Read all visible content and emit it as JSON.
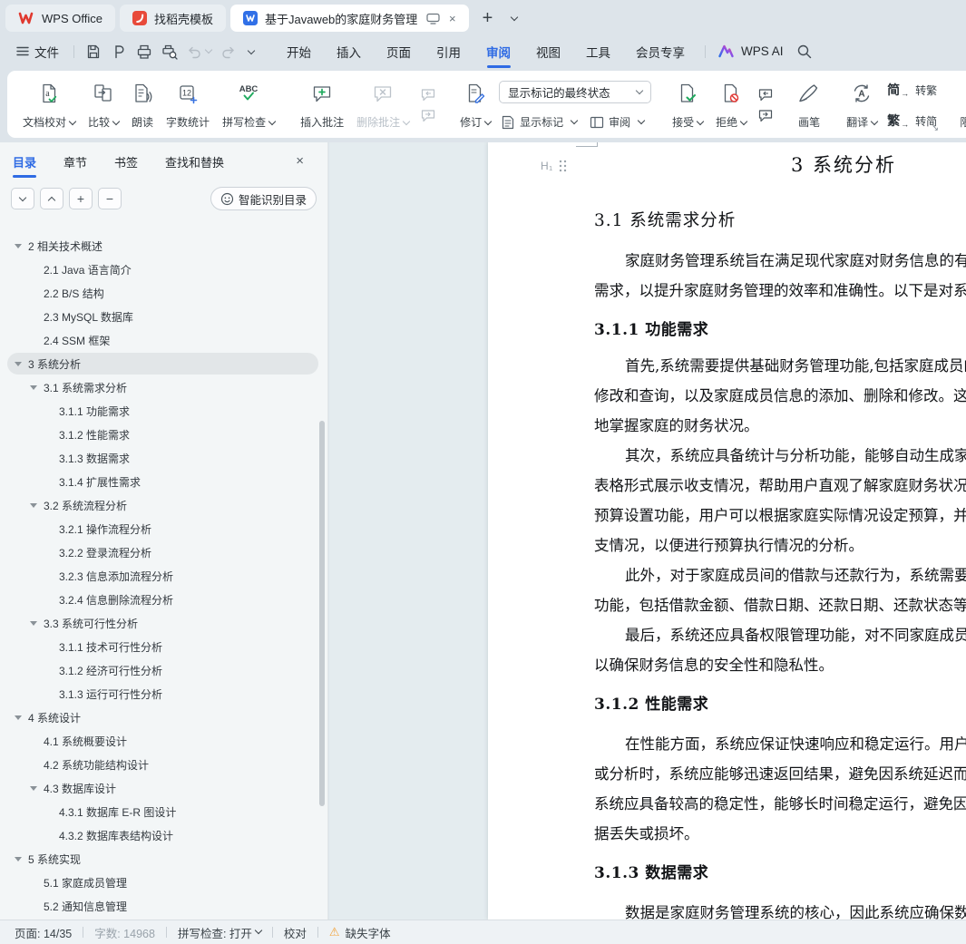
{
  "titlebar": {
    "tabs": [
      {
        "label": "WPS Office"
      },
      {
        "label": "找稻壳模板"
      },
      {
        "label": "基于Javaweb的家庭财务管理",
        "active": true
      }
    ]
  },
  "icons": {
    "plus": "+",
    "minus": "−",
    "close": "×",
    "warning": "⚠",
    "new_tab": "+",
    "corner_arrow": "↘",
    "h1_badge": "H₁"
  },
  "menubar": {
    "file": "文件",
    "items": [
      {
        "label": "开始"
      },
      {
        "label": "插入"
      },
      {
        "label": "页面"
      },
      {
        "label": "引用"
      },
      {
        "label": "审阅",
        "active": true
      },
      {
        "label": "视图"
      },
      {
        "label": "工具"
      },
      {
        "label": "会员专享"
      }
    ],
    "wps_ai": "WPS AI"
  },
  "ribbon": {
    "doc_proof": "文档校对",
    "compare": "比较",
    "read_aloud": "朗读",
    "word_count": "字数统计",
    "spell_check": "拼写检查",
    "insert_comment": "插入批注",
    "delete_comment": "删除批注",
    "track_changes": "修订",
    "markup_state": "显示标记的最终状态",
    "show_markup": "显示标记",
    "review_pane": "审阅",
    "accept": "接受",
    "reject": "拒绝",
    "pen": "画笔",
    "translate": "翻译",
    "jian": "简",
    "fan": "繁",
    "to_trad": "转繁",
    "to_simp": "转简",
    "restrict": "限制编辑"
  },
  "sidebar": {
    "tabs": [
      {
        "label": "目录",
        "active": true
      },
      {
        "label": "章节"
      },
      {
        "label": "书签"
      },
      {
        "label": "查找和替换"
      }
    ],
    "smart_toc": "智能识别目录",
    "toc": [
      {
        "level": 1,
        "text": "2  相关技术概述",
        "expandable": true
      },
      {
        "level": 2,
        "text": "2.1 Java 语言简介"
      },
      {
        "level": 2,
        "text": "2.2 B/S 结构"
      },
      {
        "level": 2,
        "text": "2.3 MySQL 数据库"
      },
      {
        "level": 2,
        "text": "2.4 SSM 框架"
      },
      {
        "level": 1,
        "text": "3  系统分析",
        "expandable": true,
        "selected": true
      },
      {
        "level": 2,
        "text": "3.1  系统需求分析",
        "expandable": true
      },
      {
        "level": 3,
        "text": "3.1.1 功能需求"
      },
      {
        "level": 3,
        "text": "3.1.2 性能需求"
      },
      {
        "level": 3,
        "text": "3.1.3 数据需求"
      },
      {
        "level": 3,
        "text": "3.1.4 扩展性需求"
      },
      {
        "level": 2,
        "text": "3.2 系统流程分析",
        "expandable": true
      },
      {
        "level": 3,
        "text": "3.2.1  操作流程分析"
      },
      {
        "level": 3,
        "text": "3.2.2  登录流程分析"
      },
      {
        "level": 3,
        "text": "3.2.3  信息添加流程分析"
      },
      {
        "level": 3,
        "text": "3.2.4  信息删除流程分析"
      },
      {
        "level": 2,
        "text": "3.3  系统可行性分析",
        "expandable": true
      },
      {
        "level": 3,
        "text": "3.1.1  技术可行性分析"
      },
      {
        "level": 3,
        "text": "3.1.2  经济可行性分析"
      },
      {
        "level": 3,
        "text": "3.1.3  运行可行性分析"
      },
      {
        "level": 1,
        "text": "4  系统设计",
        "expandable": true
      },
      {
        "level": 2,
        "text": "4.1  系统概要设计"
      },
      {
        "level": 2,
        "text": "4.2  系统功能结构设计"
      },
      {
        "level": 2,
        "text": "4.3  数据库设计",
        "expandable": true
      },
      {
        "level": 3,
        "text": "4.3.1  数据库 E-R 图设计"
      },
      {
        "level": 3,
        "text": "4.3.2  数据库表结构设计"
      },
      {
        "level": 1,
        "text": "5  系统实现",
        "expandable": true
      },
      {
        "level": 2,
        "text": "5.1 家庭成员管理"
      },
      {
        "level": 2,
        "text": "5.2  通知信息管理"
      },
      {
        "level": 2,
        "text": "5.3  收支信息管理"
      }
    ]
  },
  "document": {
    "chapter_heading": "3  系统分析",
    "lines": [
      {
        "type": "h2",
        "text": "3.1  系统需求分析"
      },
      {
        "type": "body",
        "first": true,
        "indent": true,
        "text": "家庭财务管理系统旨在满足现代家庭对财务信息的有效管"
      },
      {
        "type": "body",
        "text": "需求，以提升家庭财务管理的效率和准确性。以下是对系统需"
      },
      {
        "type": "h3",
        "text": "3.1.1 功能需求"
      },
      {
        "type": "body",
        "indent": true,
        "text": "首先,系统需要提供基础财务管理功能,包括家庭成员的收"
      },
      {
        "type": "body",
        "text": "修改和查询，以及家庭成员信息的添加、删除和修改。这有助"
      },
      {
        "type": "body",
        "text": "地掌握家庭的财务状况。"
      },
      {
        "type": "body",
        "indent": true,
        "text": "其次，系统应具备统计与分析功能，能够自动生成家庭收"
      },
      {
        "type": "body",
        "text": "表格形式展示收支情况，帮助用户直观了解家庭财务状况。同"
      },
      {
        "type": "body",
        "text": "预算设置功能，用户可以根据家庭实际情况设定预算，并实时"
      },
      {
        "type": "body",
        "text": "支情况，以便进行预算执行情况的分析。"
      },
      {
        "type": "body",
        "indent": true,
        "text": "此外，对于家庭成员间的借款与还款行为，系统需要提供"
      },
      {
        "type": "body",
        "text": "功能，包括借款金额、借款日期、还款日期、还款状态等信息"
      },
      {
        "type": "body",
        "indent": true,
        "text": "最后，系统还应具备权限管理功能，对不同家庭成员设置"
      },
      {
        "type": "body",
        "text": "以确保财务信息的安全性和隐私性。"
      },
      {
        "type": "h3",
        "text": "3.1.2 性能需求"
      },
      {
        "type": "body",
        "first": true,
        "indent": true,
        "text": "在性能方面，系统应保证快速响应和稳定运行。用户在进"
      },
      {
        "type": "body",
        "text": "或分析时，系统应能够迅速返回结果，避免因系统延迟而影响"
      },
      {
        "type": "body",
        "text": "系统应具备较高的稳定性，能够长时间稳定运行，避免因系统"
      },
      {
        "type": "body",
        "text": "据丢失或损坏。"
      },
      {
        "type": "h3",
        "text": "3.1.3 数据需求"
      },
      {
        "type": "body",
        "first": true,
        "indent": true,
        "text": "数据是家庭财务管理系统的核心，因此系统应确保数据的"
      }
    ]
  },
  "statusbar": {
    "page": "页面: 14/35",
    "words": "字数: 14968",
    "spell": "拼写检查: 打开",
    "proof": "校对",
    "missing_font": "缺失字体"
  }
}
